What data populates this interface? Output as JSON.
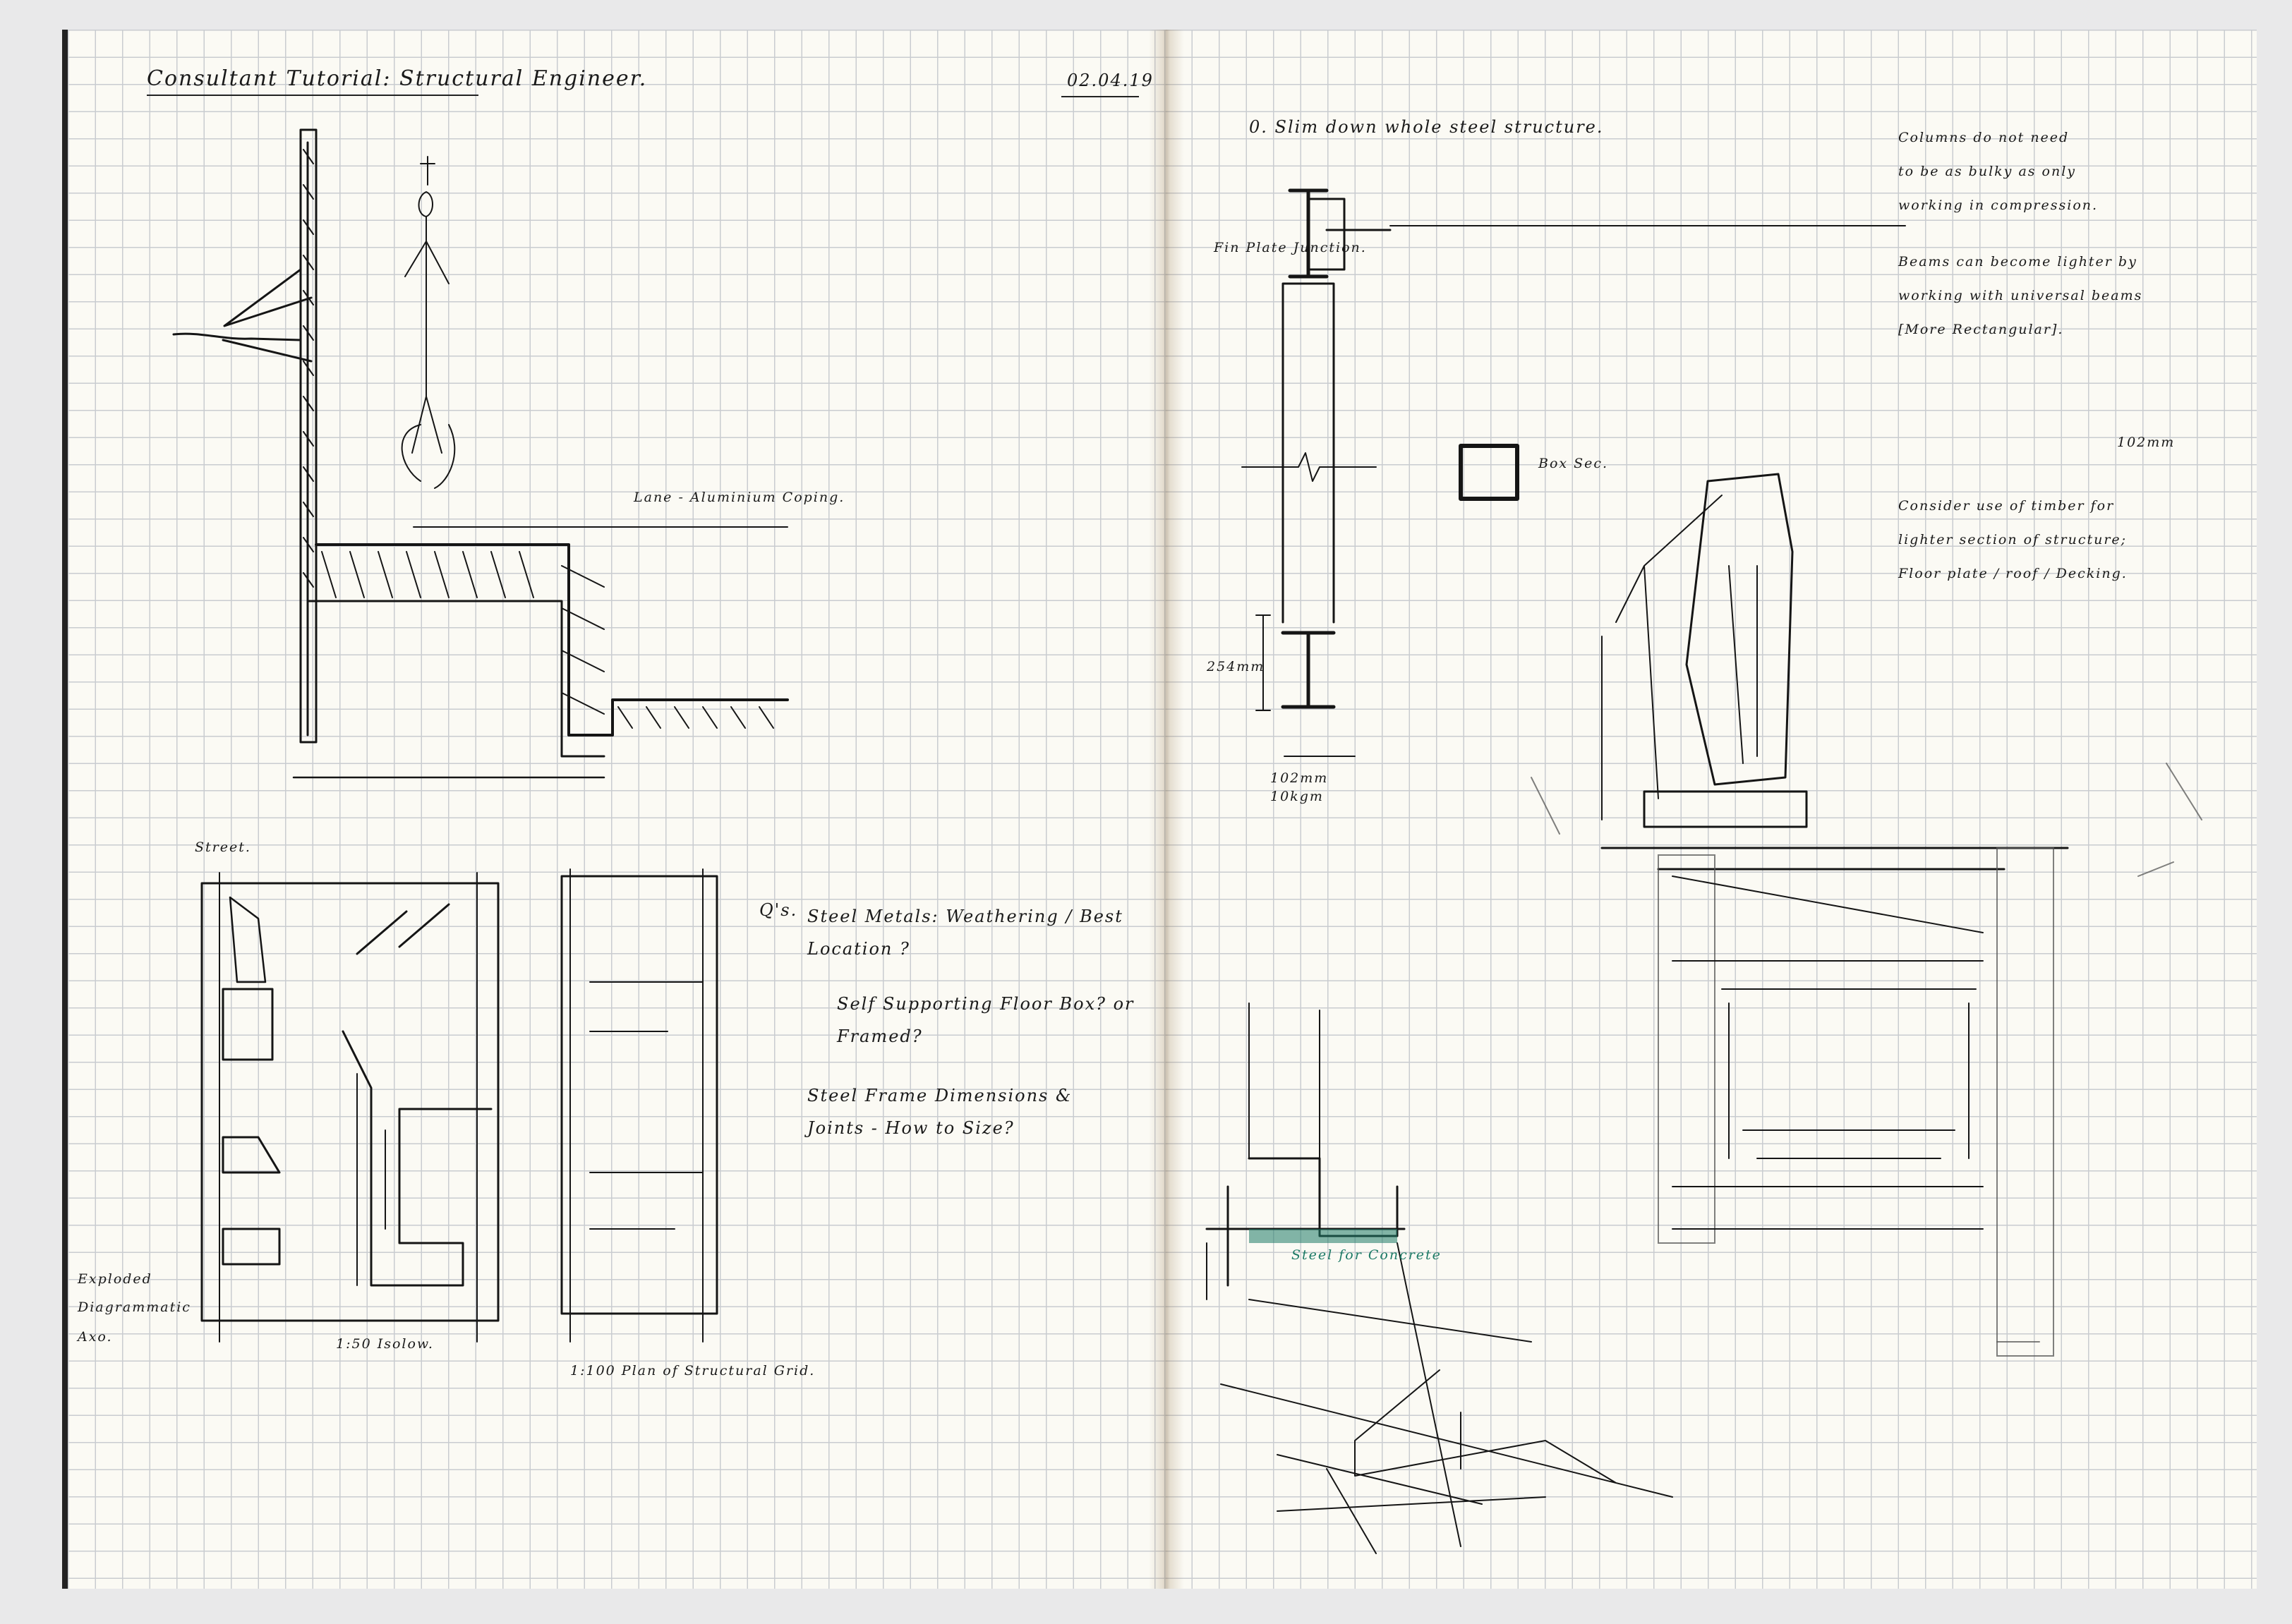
{
  "left_page": {
    "title": "Consultant Tutorial: Structural Engineer.",
    "date": "02.04.19",
    "label_section": "Lane - Aluminium Coping.",
    "label_street": "Street.",
    "label_exploded": [
      "Exploded",
      "Diagrammatic",
      "Axo."
    ],
    "label_iso": "1:50 Isolow.",
    "label_plan": "1:100 Plan of Structural Grid.",
    "questions": {
      "heading": "Q's.",
      "items": [
        "Steel Metals: Weathering / Best Location ?",
        "Self Supporting Floor Box? or Framed?",
        "Steel Frame Dimensions & Joints - How to Size?"
      ]
    }
  },
  "right_page": {
    "heading": "0. Slim down whole steel structure.",
    "label_fin_plate": "Fin Plate Junction.",
    "label_box_section": [
      "102mm",
      "Box Sec."
    ],
    "label_dim_254": "254mm",
    "label_dim_102": [
      "102mm",
      "10kgm"
    ],
    "label_concrete": "Steel for Concrete",
    "notes": [
      [
        "Columns do not need",
        "to be as bulky as only",
        "working in compression."
      ],
      [
        "Beams can become lighter by",
        "working with universal beams",
        "[More Rectangular]."
      ],
      [
        "Consider use of timber for",
        "lighter section of structure;",
        "Floor plate / roof / Decking."
      ]
    ]
  }
}
